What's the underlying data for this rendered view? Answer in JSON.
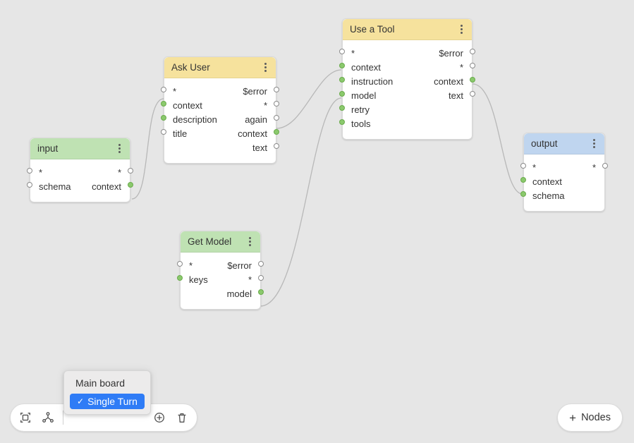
{
  "nodes": {
    "input": {
      "title": "input",
      "left_star": "*",
      "right_star": "*",
      "in1": "schema",
      "out1": "context"
    },
    "ask_user": {
      "title": "Ask User",
      "left_star": "*",
      "right_error": "$error",
      "in_context": "context",
      "right_star": "*",
      "in_description": "description",
      "out_again": "again",
      "in_title": "title",
      "out_context": "context",
      "out_text": "text"
    },
    "get_model": {
      "title": "Get Model",
      "left_star": "*",
      "right_error": "$error",
      "in_keys": "keys",
      "right_star": "*",
      "out_model": "model"
    },
    "use_tool": {
      "title": "Use a Tool",
      "left_star": "*",
      "right_error": "$error",
      "in_context": "context",
      "right_star": "*",
      "in_instruction": "instruction",
      "out_context": "context",
      "in_model": "model",
      "out_text": "text",
      "in_retry": "retry",
      "in_tools": "tools"
    },
    "output": {
      "title": "output",
      "left_star": "*",
      "right_star": "*",
      "in_context": "context",
      "in_schema": "schema"
    }
  },
  "breadcrumb": {
    "main": "Main board",
    "active": "Single Turn"
  },
  "add_nodes_label": "Nodes"
}
